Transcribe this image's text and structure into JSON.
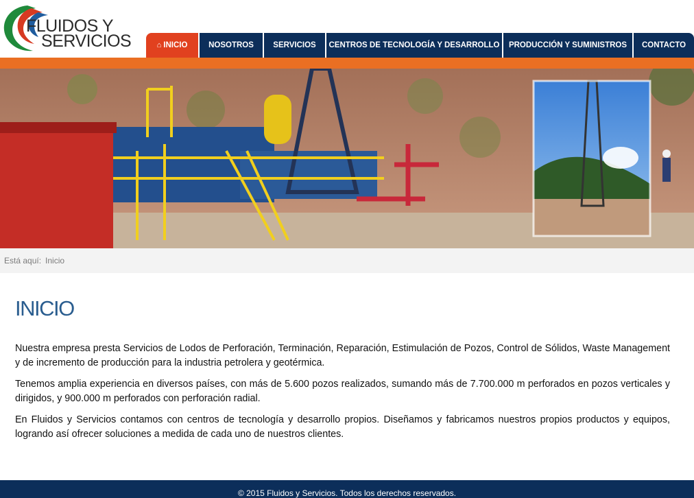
{
  "brand": {
    "line1": "FLUIDOS Y",
    "line2": "SERVICIOS",
    "colors": {
      "green": "#1f8a3b",
      "red": "#d63a22",
      "blue": "#1f5c9e"
    }
  },
  "nav": {
    "items": [
      {
        "label": "INICIO",
        "active": true,
        "icon": "home-icon"
      },
      {
        "label": "NOSOTROS"
      },
      {
        "label": "SERVICIOS"
      },
      {
        "label": "CENTROS DE TECNOLOGÍA Y DESARROLLO"
      },
      {
        "label": "PRODUCCIÓN Y SUMINISTROS"
      },
      {
        "label": "CONTACTO"
      }
    ]
  },
  "breadcrumb": {
    "prefix": "Está aquí:",
    "current": "Inicio"
  },
  "page": {
    "title": "INICIO",
    "paragraphs": [
      "Nuestra empresa presta Servicios de Lodos de Perforación, Terminación, Reparación, Estimulación de Pozos, Control de Sólidos, Waste Management y de incremento de producción para la industria petrolera y geotérmica.",
      "Tenemos amplia experiencia en diversos países, con más de 5.600 pozos realizados, sumando más de 7.700.000 m perforados en pozos verticales y dirigidos, y 900.000 m perforados con perforación radial.",
      "En Fluidos y Servicios contamos con centros de tecnología y desarrollo propios. Diseñamos y fabricamos nuestros propios productos y equipos, logrando así ofrecer soluciones a medida de cada uno de nuestros clientes."
    ]
  },
  "footer": {
    "text": "© 2015 Fluidos y Servicios. Todos los derechos reservados."
  },
  "theme": {
    "navy": "#0c2e5a",
    "orange": "#ea6f23",
    "active": "#e1411f",
    "title": "#2a5d8f"
  }
}
